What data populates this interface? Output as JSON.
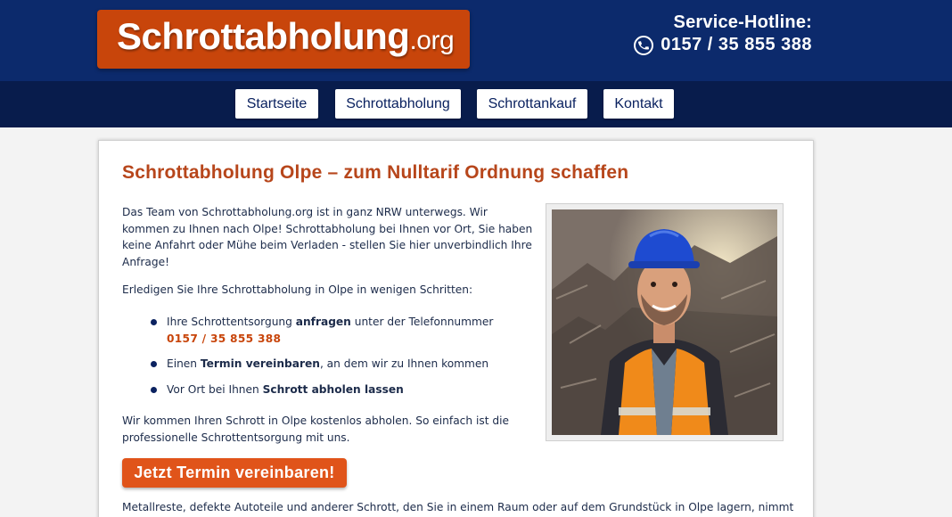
{
  "header": {
    "logo_main": "Schrottabholung",
    "logo_tld": ".org",
    "hotline_label": "Service-Hotline:",
    "hotline_number": "0157 / 35 855 388"
  },
  "nav": {
    "items": [
      "Startseite",
      "Schrottabholung",
      "Schrottankauf",
      "Kontakt"
    ]
  },
  "main": {
    "title": "Schrottabholung Olpe – zum Nulltarif Ordnung schaffen",
    "intro": "Das Team von Schrottabholung.org ist in ganz NRW unterwegs. Wir kommen zu Ihnen nach Olpe! Schrottabholung bei Ihnen vor Ort, Sie haben keine Anfahrt oder Mühe beim Verladen - stellen Sie hier unverbindlich Ihre Anfrage!",
    "steps_intro": "Erledigen Sie Ihre Schrottabholung in Olpe in wenigen Schritten:",
    "steps": [
      {
        "pre": "Ihre Schrottentsorgung ",
        "bold": "anfragen",
        "post": " unter der Telefonnummer",
        "phone": "0157 / 35 855 388"
      },
      {
        "pre": "Einen ",
        "bold": "Termin vereinbaren",
        "post": ", an dem wir zu Ihnen kommen"
      },
      {
        "pre": "Vor Ort bei Ihnen ",
        "bold": "Schrott abholen lassen",
        "post": ""
      }
    ],
    "closing": "Wir kommen Ihren Schrott in Olpe kostenlos abholen. So einfach ist die professionelle Schrottentsorgung mit uns.",
    "cta_label": "Jetzt Termin vereinbaren!",
    "bottom_text": "Metallreste, defekte Autoteile und anderer Schrott, den Sie in einem Raum oder auf dem Grundstück in Olpe lagern, nimmt"
  },
  "colors": {
    "header_bg": "#0c2a6c",
    "nav_bg": "#081c4c",
    "brand_orange": "#c8450b",
    "cta_orange": "#e0541a",
    "title_color": "#b7461b"
  },
  "icons": {
    "hotline": "phone-icon",
    "photo": "worker-photo"
  }
}
